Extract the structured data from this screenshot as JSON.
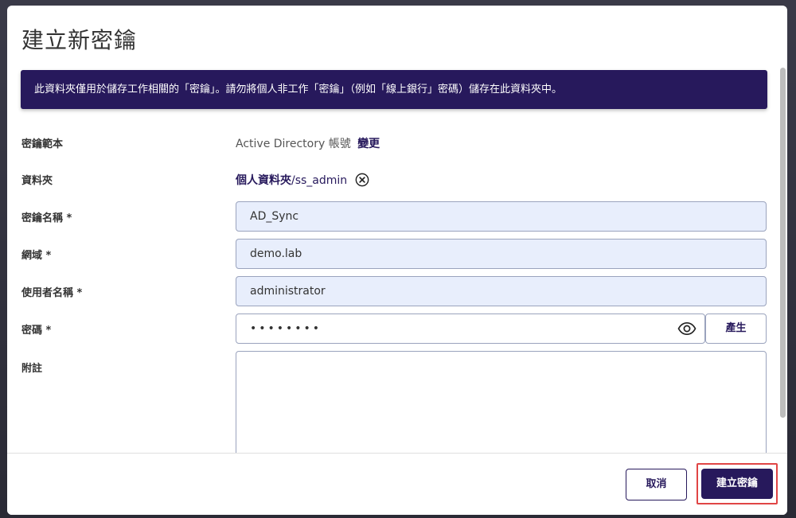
{
  "dialog": {
    "title": "建立新密鑰",
    "notice": "此資料夾僅用於儲存工作相關的「密鑰」。請勿將個人非工作「密鑰」（例如「線上銀行」密碼）儲存在此資料夾中。"
  },
  "form": {
    "template_label": "密鑰範本",
    "template_value": "Active Directory 帳號",
    "template_change": "變更",
    "folder_label": "資料夾",
    "folder_name": "個人資料夾",
    "folder_path": "/ss_admin",
    "secret_name_label": "密鑰名稱 *",
    "secret_name_value": "AD_Sync",
    "domain_label": "網域 *",
    "domain_value": "demo.lab",
    "username_label": "使用者名稱 *",
    "username_value": "administrator",
    "password_label": "密碼 *",
    "password_value": "••••••••",
    "generate_label": "產生",
    "notes_label": "附註",
    "notes_value": ""
  },
  "footer": {
    "cancel_label": "取消",
    "create_label": "建立密鑰"
  },
  "icons": {
    "clear_folder": "close-circle-icon",
    "show_password": "eye-icon"
  },
  "colors": {
    "brand": "#27195c",
    "input_fill": "#e8eefc",
    "highlight": "#e04545"
  }
}
